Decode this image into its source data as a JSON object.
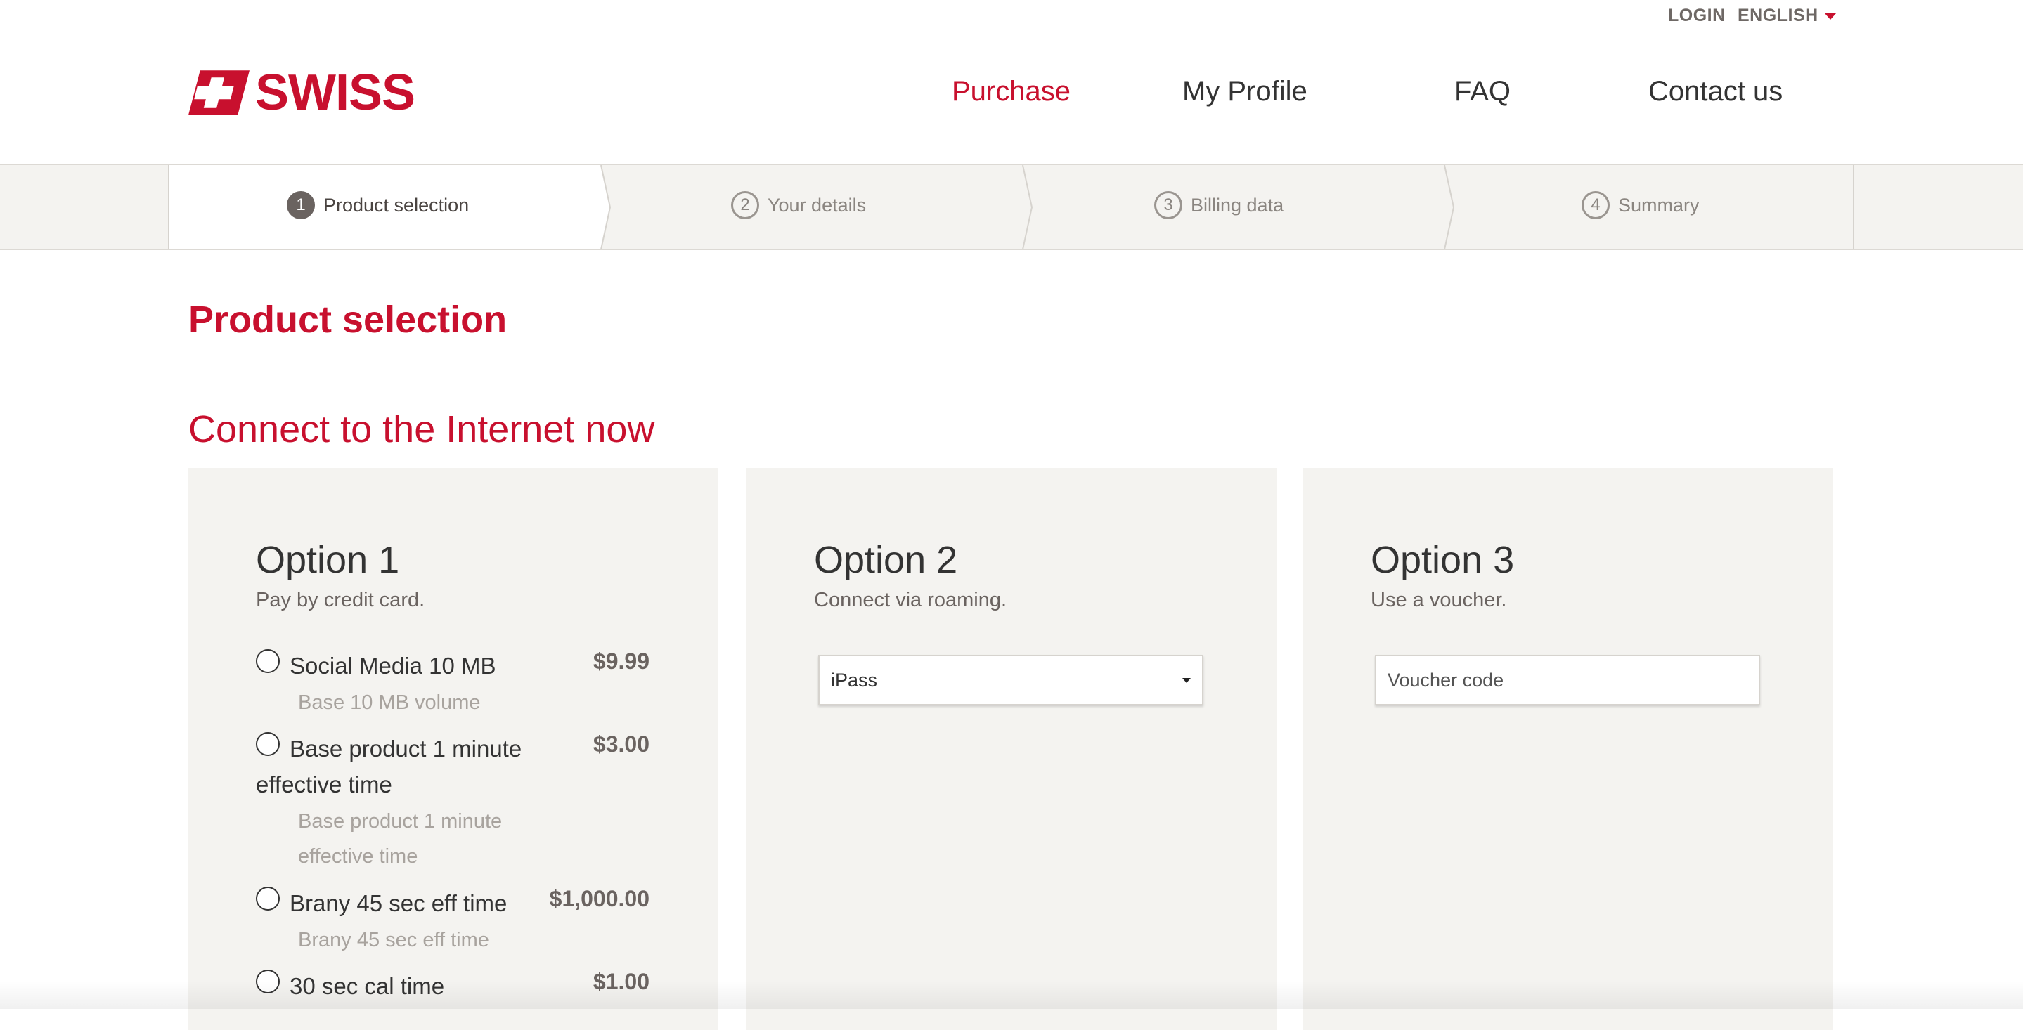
{
  "topbar": {
    "login": "LOGIN",
    "language": "ENGLISH"
  },
  "header": {
    "logo_text": "SWISS",
    "nav": [
      {
        "label": "Purchase",
        "active": true
      },
      {
        "label": "My Profile"
      },
      {
        "label": "FAQ"
      },
      {
        "label": "Contact us"
      }
    ]
  },
  "stepper": {
    "steps": [
      {
        "number": "1",
        "label": "Product selection",
        "active": true
      },
      {
        "number": "2",
        "label": "Your details"
      },
      {
        "number": "3",
        "label": "Billing data"
      },
      {
        "number": "4",
        "label": "Summary"
      }
    ]
  },
  "main": {
    "page_title": "Product selection",
    "section_title": "Connect to the Internet now",
    "options": [
      {
        "title": "Option 1",
        "subtitle": "Pay by credit card.",
        "products": [
          {
            "name": "Social Media 10 MB",
            "price": "$9.99",
            "desc": "Base 10 MB volume"
          },
          {
            "name": "Base product 1 minute effective time",
            "price": "$3.00",
            "desc": "Base product 1 minute effective time"
          },
          {
            "name": "Brany 45 sec eff time",
            "price": "$1,000.00",
            "desc": "Brany 45 sec eff time"
          },
          {
            "name": "30 sec cal time",
            "price": "$1.00",
            "desc": ""
          }
        ]
      },
      {
        "title": "Option 2",
        "subtitle": "Connect via roaming.",
        "select_value": "iPass"
      },
      {
        "title": "Option 3",
        "subtitle": "Use a voucher.",
        "voucher_placeholder": "Voucher code"
      }
    ]
  },
  "colors": {
    "brand_red": "#c8102e",
    "panel_bg": "#f4f3f0",
    "text": "#333333"
  }
}
